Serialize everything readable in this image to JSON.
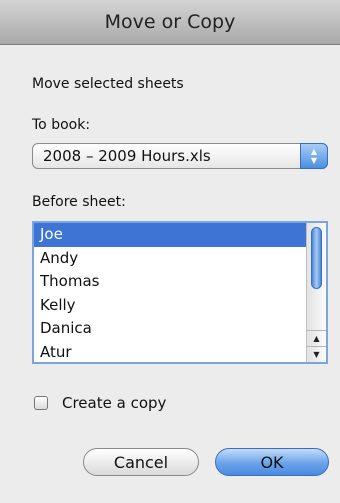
{
  "window": {
    "title": "Move or Copy"
  },
  "dialog": {
    "heading": "Move selected sheets",
    "to_book_label": "To book:",
    "to_book_value": "2008 – 2009 Hours.xls",
    "before_sheet_label": "Before sheet:",
    "sheets": [
      "Joe",
      "Andy",
      "Thomas",
      "Kelly",
      "Danica",
      "Atur"
    ],
    "selected_sheet": "Joe",
    "create_copy_label": "Create a copy",
    "create_copy_checked": false,
    "cancel_label": "Cancel",
    "ok_label": "OK"
  },
  "icons": {
    "popup_arrows": "up-down-arrows-icon",
    "scroll_up": "scroll-up-arrow-icon",
    "scroll_down": "scroll-down-arrow-icon"
  },
  "colors": {
    "selection": "#3d74d5",
    "accent": "#4c8fe0"
  }
}
